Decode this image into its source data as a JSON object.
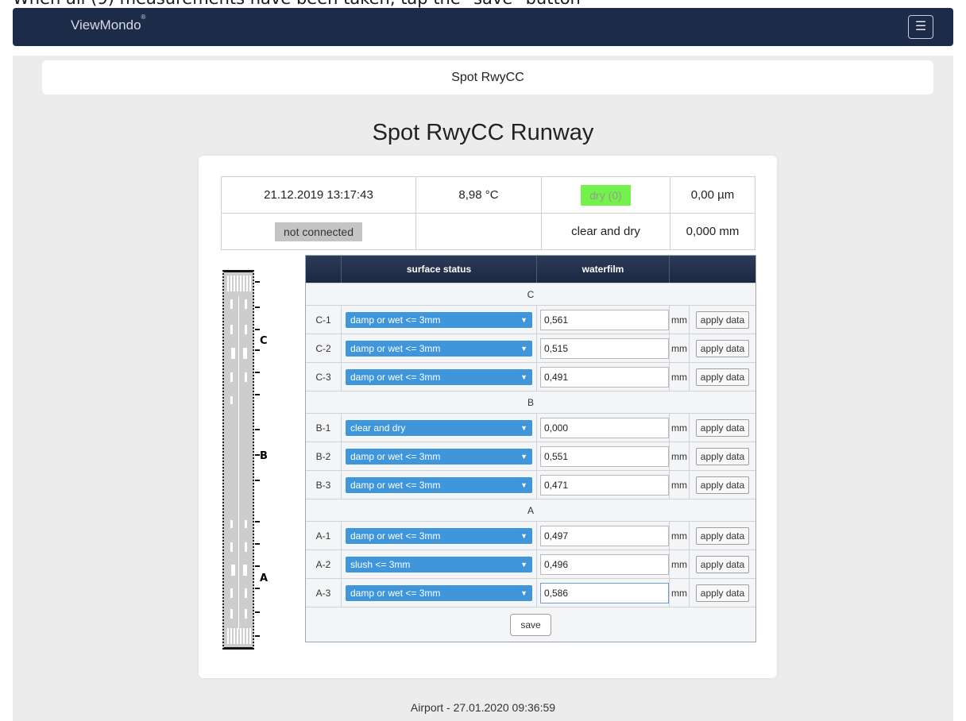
{
  "instruction": "When all (9) measurements have been taken, tap the \"save\" button",
  "navbar": {
    "brand": "ViewMondo",
    "brand_mark": "®",
    "menu_icon": "☰"
  },
  "page_header": "Spot RwyCC",
  "main_title": "Spot RwyCC Runway",
  "info": {
    "datetime": "21.12.2019 13:17:43",
    "temperature": "8,98 °C",
    "status_badge": "dry (0)",
    "status_badge_color": "#72f24a",
    "microns": "0,00 µm",
    "connection": "not connected",
    "empty": "",
    "condition": "clear and dry",
    "thickness": "0,000 mm"
  },
  "runway": {
    "labels": [
      "C",
      "B",
      "A"
    ]
  },
  "grid": {
    "columns": [
      "",
      "surface status",
      "waterfilm",
      ""
    ],
    "unit": "mm",
    "apply_label": "apply data",
    "save_label": "save",
    "groups": [
      {
        "name": "C",
        "rows": [
          {
            "id": "C-1",
            "status": "damp or wet <= 3mm",
            "value": "0,561"
          },
          {
            "id": "C-2",
            "status": "damp or wet <= 3mm",
            "value": "0,515"
          },
          {
            "id": "C-3",
            "status": "damp or wet <= 3mm",
            "value": "0,491"
          }
        ]
      },
      {
        "name": "B",
        "rows": [
          {
            "id": "B-1",
            "status": "clear and dry",
            "value": "0,000"
          },
          {
            "id": "B-2",
            "status": "damp or wet <= 3mm",
            "value": "0,551"
          },
          {
            "id": "B-3",
            "status": "damp or wet <= 3mm",
            "value": "0,471"
          }
        ]
      },
      {
        "name": "A",
        "rows": [
          {
            "id": "A-1",
            "status": "damp or wet <= 3mm",
            "value": "0,497"
          },
          {
            "id": "A-2",
            "status": "slush <= 3mm",
            "value": "0,496"
          },
          {
            "id": "A-3",
            "status": "damp or wet <= 3mm",
            "value": "0,586"
          }
        ]
      }
    ]
  },
  "footer": "Airport  -  27.01.2020 09:36:59"
}
